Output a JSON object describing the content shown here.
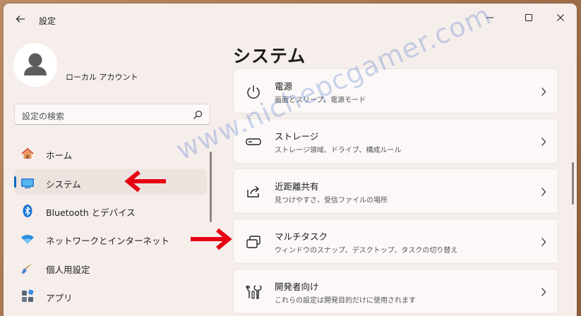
{
  "window": {
    "title": "設定"
  },
  "profile": {
    "name": "ローカル アカウント"
  },
  "search": {
    "placeholder": "設定の検索"
  },
  "nav": {
    "items": [
      {
        "label": "ホーム",
        "icon": "home-icon"
      },
      {
        "label": "システム",
        "icon": "system-icon",
        "active": true
      },
      {
        "label": "Bluetooth とデバイス",
        "icon": "bluetooth-icon"
      },
      {
        "label": "ネットワークとインターネット",
        "icon": "wifi-icon"
      },
      {
        "label": "個人用設定",
        "icon": "brush-icon"
      },
      {
        "label": "アプリ",
        "icon": "apps-icon"
      }
    ]
  },
  "main": {
    "title": "システム",
    "cards": [
      {
        "title": "電源",
        "subtitle": "画面とスリープ、電源モード",
        "icon": "power-icon"
      },
      {
        "title": "ストレージ",
        "subtitle": "ストレージ領域、ドライブ、構成ルール",
        "icon": "storage-icon"
      },
      {
        "title": "近距離共有",
        "subtitle": "見つけやすさ、受信ファイルの場所",
        "icon": "share-icon"
      },
      {
        "title": "マルチタスク",
        "subtitle": "ウィンドウのスナップ、デスクトップ、タスクの切り替え",
        "icon": "multitask-icon"
      },
      {
        "title": "開発者向け",
        "subtitle": "これらの設定は開発目的だけに使用されます",
        "icon": "developer-icon"
      }
    ]
  },
  "watermark": "www.nichepcgamer.com",
  "colors": {
    "accent": "#0067c0",
    "annotation_arrow": "#e60012"
  }
}
